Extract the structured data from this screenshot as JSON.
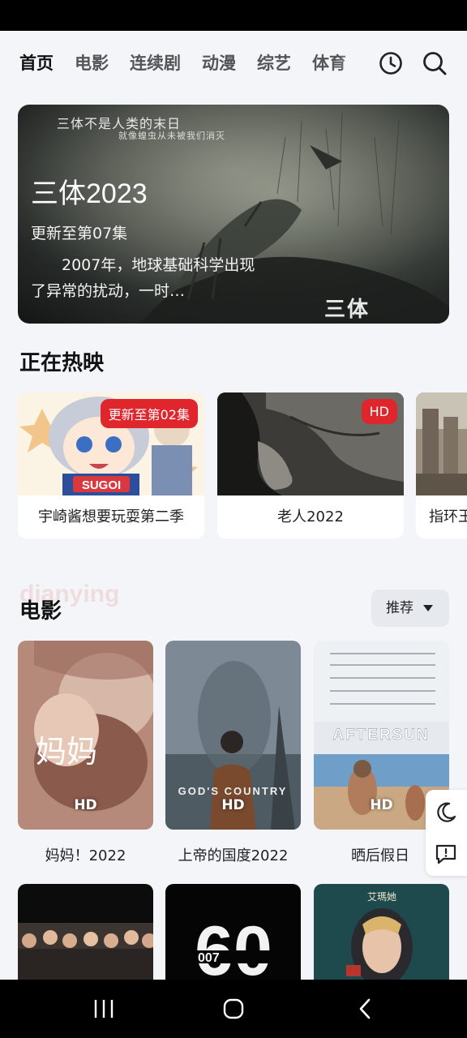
{
  "tabs": [
    {
      "label": "首页",
      "active": true
    },
    {
      "label": "电影",
      "active": false
    },
    {
      "label": "连续剧",
      "active": false
    },
    {
      "label": "动漫",
      "active": false
    },
    {
      "label": "综艺",
      "active": false
    },
    {
      "label": "体育",
      "active": false
    }
  ],
  "nav_icons": [
    "history-icon",
    "search-icon"
  ],
  "banner": {
    "title": "三体2023",
    "episode": "更新至第07集",
    "description": "2007年，地球基础科学出现了异常的扰动，一时…",
    "poster_tagline": "三体不是人类的末日",
    "poster_tagline_sub": "就像蝗虫从未被我们消灭",
    "poster_logo": "三体"
  },
  "now_showing": {
    "title": "正在热映",
    "items": [
      {
        "title": "宇崎酱想要玩耍第二季",
        "badge": "更新至第02集",
        "art_text": "SUGOI"
      },
      {
        "title": "老人2022",
        "badge": "HD"
      },
      {
        "title": "指环王",
        "badge": ""
      }
    ]
  },
  "movies": {
    "title": "电影",
    "watermark": "dianying",
    "sort_label": "推荐",
    "items": [
      {
        "title": "妈妈！2022",
        "badge": "HD",
        "art_text": "妈妈"
      },
      {
        "title": "上帝的国度2022",
        "badge": "HD",
        "art_text": "GOD'S COUNTRY"
      },
      {
        "title": "晒后假日",
        "badge": "HD",
        "art_text": "AFTERSUN"
      }
    ],
    "next_row": [
      {
        "art_text": ""
      },
      {
        "art_text": "60"
      },
      {
        "art_text": "艾瑪她"
      }
    ]
  },
  "side_tools": [
    "moon-icon",
    "feedback-icon"
  ],
  "system_nav": [
    "recent-apps-icon",
    "home-icon",
    "back-icon"
  ],
  "colors": {
    "accent": "#e0262d",
    "tab_highlight": "#f6c343",
    "background": "#f3f5f8"
  }
}
